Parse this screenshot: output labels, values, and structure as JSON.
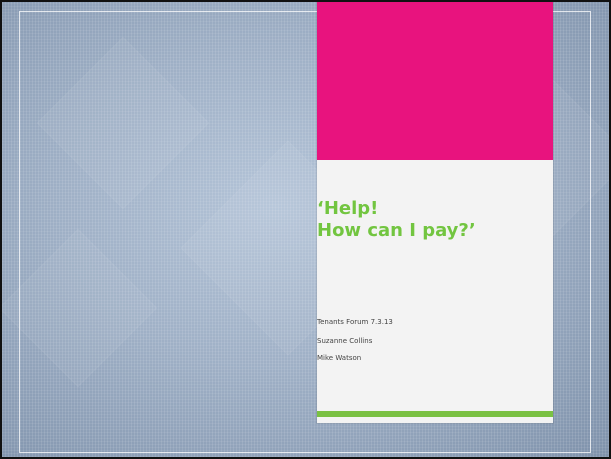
{
  "slide": {
    "title": "‘Help!\nHow can I pay?’",
    "subtitle_lines": [
      "Tenants Forum 7.3.13",
      "Suzanne Collins",
      "Mike Watson"
    ]
  },
  "colors": {
    "accent_pink": "#e8137e",
    "title_green": "#72c540",
    "bar_green": "#7ac143",
    "background": "#9fb0c6"
  }
}
